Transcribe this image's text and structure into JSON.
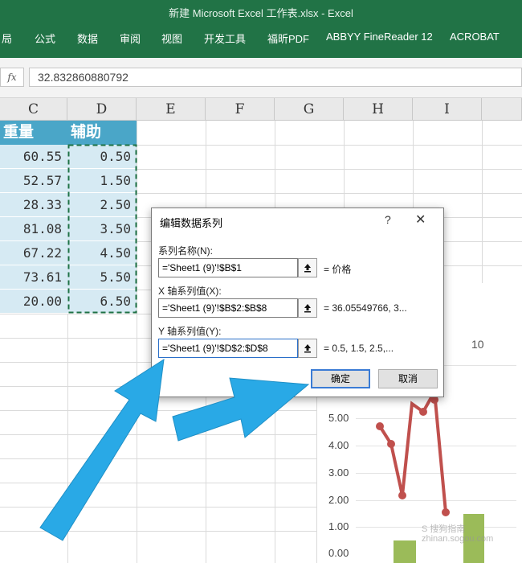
{
  "window": {
    "title": "新建 Microsoft Excel 工作表.xlsx  -  Excel"
  },
  "ribbon": {
    "tabs": [
      "局",
      "公式",
      "数据",
      "审阅",
      "视图",
      "开发工具",
      "福昕PDF",
      "ABBYY FineReader 12",
      "ACROBAT"
    ]
  },
  "formula_bar": {
    "fx_label": "fx",
    "value": "32.832860880792"
  },
  "columns": [
    "C",
    "D",
    "E",
    "F",
    "G",
    "H",
    "I"
  ],
  "table": {
    "headers": [
      "重量",
      "辅助"
    ],
    "rows": [
      [
        "60.55",
        "0.50"
      ],
      [
        "52.57",
        "1.50"
      ],
      [
        "28.33",
        "2.50"
      ],
      [
        "81.08",
        "3.50"
      ],
      [
        "67.22",
        "4.50"
      ],
      [
        "73.61",
        "5.50"
      ],
      [
        "20.00",
        "6.50"
      ]
    ]
  },
  "dialog": {
    "title": "编辑数据系列",
    "help": "?",
    "close": "✕",
    "series_name_label": "系列名称(N):",
    "series_name_value": "='Sheet1 (9)'!$B$1",
    "series_name_preview": "= 价格",
    "x_label": "X 轴系列值(X):",
    "x_value": "='Sheet1 (9)'!$B$2:$B$8",
    "x_preview": "= 36.05549766, 3...",
    "y_label": "Y 轴系列值(Y):",
    "y_value": "='Sheet1 (9)'!$D$2:$D$8",
    "y_preview": "= 0.5, 1.5, 2.5,...",
    "ok": "确定",
    "cancel": "取消",
    "collapse_icon": "collapse-range-icon"
  },
  "chart": {
    "y_ticks": [
      "5.00",
      "4.00",
      "3.00",
      "2.00",
      "1.00",
      "0.00"
    ],
    "number_label": "10",
    "watermark_line1": "S 搜狗指南",
    "watermark_line2": "zhinan.sogou.com"
  },
  "colors": {
    "ribbon": "#217346",
    "table_header": "#4aa6c8",
    "table_cell": "#d6eaf3",
    "arrow": "#29a9e6",
    "line_series": "#c0504d",
    "bar_series": "#9bbb59"
  }
}
